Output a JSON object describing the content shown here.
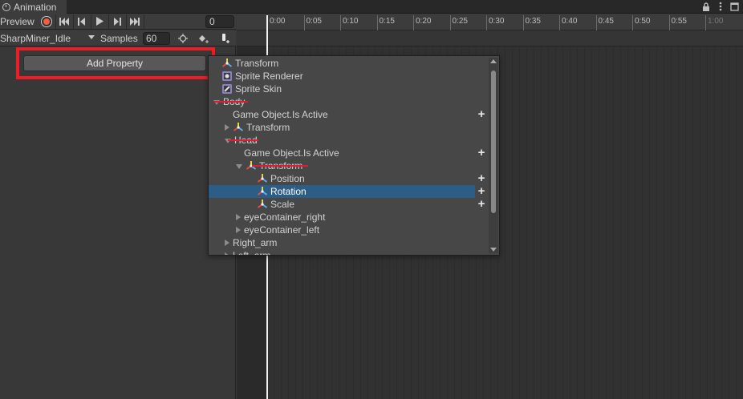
{
  "window": {
    "tab_title": "Animation"
  },
  "toolbar": {
    "preview_label": "Preview",
    "frame_value": "0",
    "clip_name": "SharpMiner_Idle",
    "samples_label": "Samples",
    "samples_value": "60"
  },
  "left_panel": {
    "add_property_label": "Add Property"
  },
  "timeline": {
    "ticks": [
      "0:00",
      "0:05",
      "0:10",
      "0:15",
      "0:20",
      "0:25",
      "0:30",
      "0:35",
      "0:40",
      "0:45",
      "0:50",
      "0:55",
      "1:00"
    ]
  },
  "dropdown": {
    "rows": [
      {
        "label": "Transform",
        "icon": "transform-icon",
        "arrow": "none",
        "plus": false
      },
      {
        "label": "Sprite Renderer",
        "icon": "sprite-renderer-icon",
        "arrow": "none",
        "plus": false
      },
      {
        "label": "Sprite Skin",
        "icon": "sprite-skin-icon",
        "arrow": "none",
        "plus": false
      },
      {
        "label": "Body",
        "icon": "",
        "arrow": "down",
        "plus": false
      },
      {
        "label": "Game Object.Is Active",
        "icon": "",
        "arrow": "none",
        "plus": true
      },
      {
        "label": "Transform",
        "icon": "transform-icon",
        "arrow": "right",
        "plus": false
      },
      {
        "label": "Head",
        "icon": "",
        "arrow": "down",
        "plus": false
      },
      {
        "label": "Game Object.Is Active",
        "icon": "",
        "arrow": "none",
        "plus": true
      },
      {
        "label": "Transform",
        "icon": "transform-icon",
        "arrow": "down",
        "plus": false
      },
      {
        "label": "Position",
        "icon": "transform-icon",
        "arrow": "none",
        "plus": true
      },
      {
        "label": "Rotation",
        "icon": "transform-icon",
        "arrow": "none",
        "plus": true,
        "selected": true
      },
      {
        "label": "Scale",
        "icon": "transform-icon",
        "arrow": "none",
        "plus": true
      },
      {
        "label": "eyeContainer_right",
        "icon": "",
        "arrow": "right",
        "plus": false
      },
      {
        "label": "eyeContainer_left",
        "icon": "",
        "arrow": "right",
        "plus": false
      },
      {
        "label": "Right_arm",
        "icon": "",
        "arrow": "right",
        "plus": false
      },
      {
        "label": "Left_arm",
        "icon": "",
        "arrow": "right",
        "plus": false
      }
    ]
  },
  "colors": {
    "selection": "#2c5d87",
    "annotation_red": "#ee1c25",
    "record": "#f06040"
  }
}
